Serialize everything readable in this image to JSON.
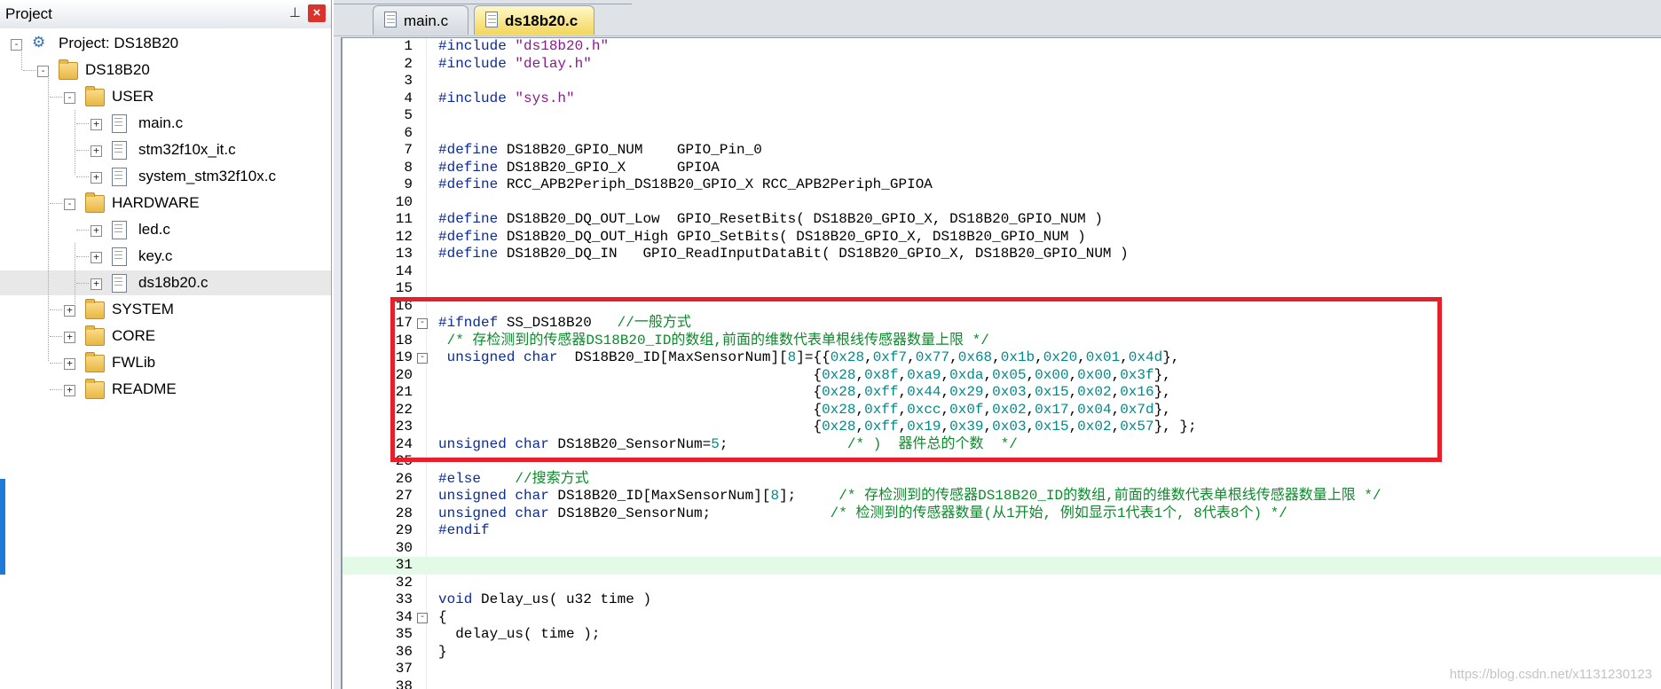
{
  "panel": {
    "title": "Project",
    "pin_icon": "pin-icon",
    "close_icon": "close-icon",
    "close_color": "#d9342b"
  },
  "tree": {
    "project_label": "Project: DS18B20",
    "target_label": "DS18B20",
    "groups": [
      {
        "name": "USER",
        "files": [
          "main.c",
          "stm32f10x_it.c",
          "system_stm32f10x.c"
        ]
      },
      {
        "name": "HARDWARE",
        "files": [
          "led.c",
          "key.c",
          "ds18b20.c"
        ]
      },
      {
        "name": "SYSTEM",
        "files": []
      },
      {
        "name": "CORE",
        "files": []
      },
      {
        "name": "FWLib",
        "files": []
      },
      {
        "name": "README",
        "files": []
      }
    ],
    "selected_file": "ds18b20.c"
  },
  "tabs": [
    {
      "label": "main.c",
      "active": false
    },
    {
      "label": "ds18b20.c",
      "active": true
    }
  ],
  "code_lines": [
    {
      "n": "1",
      "parts": [
        [
          "pp",
          "#include "
        ],
        [
          "str",
          "\"ds18b20.h\""
        ]
      ]
    },
    {
      "n": "2",
      "parts": [
        [
          "pp",
          "#include "
        ],
        [
          "str",
          "\"delay.h\""
        ]
      ]
    },
    {
      "n": "3",
      "parts": []
    },
    {
      "n": "4",
      "parts": [
        [
          "pp",
          "#include "
        ],
        [
          "str",
          "\"sys.h\""
        ]
      ]
    },
    {
      "n": "5",
      "parts": []
    },
    {
      "n": "6",
      "parts": []
    },
    {
      "n": "7",
      "parts": [
        [
          "pp",
          "#define "
        ],
        [
          "pl",
          "DS18B20_GPIO_NUM    GPIO_Pin_0"
        ]
      ]
    },
    {
      "n": "8",
      "parts": [
        [
          "pp",
          "#define "
        ],
        [
          "pl",
          "DS18B20_GPIO_X      GPIOA"
        ]
      ]
    },
    {
      "n": "9",
      "parts": [
        [
          "pp",
          "#define "
        ],
        [
          "pl",
          "RCC_APB2Periph_DS18B20_GPIO_X RCC_APB2Periph_GPIOA"
        ]
      ]
    },
    {
      "n": "10",
      "parts": []
    },
    {
      "n": "11",
      "parts": [
        [
          "pp",
          "#define "
        ],
        [
          "pl",
          "DS18B20_DQ_OUT_Low  GPIO_ResetBits( DS18B20_GPIO_X, DS18B20_GPIO_NUM )"
        ]
      ]
    },
    {
      "n": "12",
      "parts": [
        [
          "pp",
          "#define "
        ],
        [
          "pl",
          "DS18B20_DQ_OUT_High GPIO_SetBits( DS18B20_GPIO_X, DS18B20_GPIO_NUM )"
        ]
      ]
    },
    {
      "n": "13",
      "parts": [
        [
          "pp",
          "#define "
        ],
        [
          "pl",
          "DS18B20_DQ_IN   GPIO_ReadInputDataBit( DS18B20_GPIO_X, DS18B20_GPIO_NUM )"
        ]
      ]
    },
    {
      "n": "14",
      "parts": []
    },
    {
      "n": "15",
      "parts": []
    },
    {
      "n": "16",
      "parts": []
    },
    {
      "n": "17",
      "fold": "-",
      "parts": [
        [
          "pp",
          "#ifndef "
        ],
        [
          "pl",
          "SS_DS18B20   "
        ],
        [
          "cm",
          "//一般方式"
        ]
      ]
    },
    {
      "n": "18",
      "parts": [
        [
          "cm",
          " /* 存检测到的传感器DS18B20_ID的数组,前面的维数代表单根线传感器数量上限 */"
        ]
      ]
    },
    {
      "n": "19",
      "fold": "-",
      "parts": [
        [
          "kw",
          " unsigned char "
        ],
        [
          "pl",
          " DS18B20_ID[MaxSensorNum]["
        ],
        [
          "num",
          "8"
        ],
        [
          "pl",
          "]={{"
        ],
        [
          "num",
          "0x28"
        ],
        [
          "pl",
          ","
        ],
        [
          "num",
          "0xf7"
        ],
        [
          "pl",
          ","
        ],
        [
          "num",
          "0x77"
        ],
        [
          "pl",
          ","
        ],
        [
          "num",
          "0x68"
        ],
        [
          "pl",
          ","
        ],
        [
          "num",
          "0x1b"
        ],
        [
          "pl",
          ","
        ],
        [
          "num",
          "0x20"
        ],
        [
          "pl",
          ","
        ],
        [
          "num",
          "0x01"
        ],
        [
          "pl",
          ","
        ],
        [
          "num",
          "0x4d"
        ],
        [
          "pl",
          "},"
        ]
      ]
    },
    {
      "n": "20",
      "parts": [
        [
          "pl",
          "                                            {"
        ],
        [
          "num",
          "0x28"
        ],
        [
          "pl",
          ","
        ],
        [
          "num",
          "0x8f"
        ],
        [
          "pl",
          ","
        ],
        [
          "num",
          "0xa9"
        ],
        [
          "pl",
          ","
        ],
        [
          "num",
          "0xda"
        ],
        [
          "pl",
          ","
        ],
        [
          "num",
          "0x05"
        ],
        [
          "pl",
          ","
        ],
        [
          "num",
          "0x00"
        ],
        [
          "pl",
          ","
        ],
        [
          "num",
          "0x00"
        ],
        [
          "pl",
          ","
        ],
        [
          "num",
          "0x3f"
        ],
        [
          "pl",
          "},"
        ]
      ]
    },
    {
      "n": "21",
      "parts": [
        [
          "pl",
          "                                            {"
        ],
        [
          "num",
          "0x28"
        ],
        [
          "pl",
          ","
        ],
        [
          "num",
          "0xff"
        ],
        [
          "pl",
          ","
        ],
        [
          "num",
          "0x44"
        ],
        [
          "pl",
          ","
        ],
        [
          "num",
          "0x29"
        ],
        [
          "pl",
          ","
        ],
        [
          "num",
          "0x03"
        ],
        [
          "pl",
          ","
        ],
        [
          "num",
          "0x15"
        ],
        [
          "pl",
          ","
        ],
        [
          "num",
          "0x02"
        ],
        [
          "pl",
          ","
        ],
        [
          "num",
          "0x16"
        ],
        [
          "pl",
          "},"
        ]
      ]
    },
    {
      "n": "22",
      "parts": [
        [
          "pl",
          "                                            {"
        ],
        [
          "num",
          "0x28"
        ],
        [
          "pl",
          ","
        ],
        [
          "num",
          "0xff"
        ],
        [
          "pl",
          ","
        ],
        [
          "num",
          "0xcc"
        ],
        [
          "pl",
          ","
        ],
        [
          "num",
          "0x0f"
        ],
        [
          "pl",
          ","
        ],
        [
          "num",
          "0x02"
        ],
        [
          "pl",
          ","
        ],
        [
          "num",
          "0x17"
        ],
        [
          "pl",
          ","
        ],
        [
          "num",
          "0x04"
        ],
        [
          "pl",
          ","
        ],
        [
          "num",
          "0x7d"
        ],
        [
          "pl",
          "},"
        ]
      ]
    },
    {
      "n": "23",
      "parts": [
        [
          "pl",
          "                                            {"
        ],
        [
          "num",
          "0x28"
        ],
        [
          "pl",
          ","
        ],
        [
          "num",
          "0xff"
        ],
        [
          "pl",
          ","
        ],
        [
          "num",
          "0x19"
        ],
        [
          "pl",
          ","
        ],
        [
          "num",
          "0x39"
        ],
        [
          "pl",
          ","
        ],
        [
          "num",
          "0x03"
        ],
        [
          "pl",
          ","
        ],
        [
          "num",
          "0x15"
        ],
        [
          "pl",
          ","
        ],
        [
          "num",
          "0x02"
        ],
        [
          "pl",
          ","
        ],
        [
          "num",
          "0x57"
        ],
        [
          "pl",
          "}, };"
        ]
      ]
    },
    {
      "n": "24",
      "parts": [
        [
          "kw",
          "unsigned char "
        ],
        [
          "pl",
          "DS18B20_SensorNum="
        ],
        [
          "num",
          "5"
        ],
        [
          "pl",
          ";              "
        ],
        [
          "cm",
          "/* )  器件总的个数  */"
        ]
      ]
    },
    {
      "n": "25",
      "parts": []
    },
    {
      "n": "26",
      "parts": [
        [
          "pp",
          "#else    "
        ],
        [
          "cm",
          "//搜索方式"
        ]
      ]
    },
    {
      "n": "27",
      "parts": [
        [
          "kw",
          "unsigned char "
        ],
        [
          "pl",
          "DS18B20_ID[MaxSensorNum]["
        ],
        [
          "num",
          "8"
        ],
        [
          "pl",
          "];     "
        ],
        [
          "cm",
          "/* 存检测到的传感器DS18B20_ID的数组,前面的维数代表单根线传感器数量上限 */"
        ]
      ]
    },
    {
      "n": "28",
      "parts": [
        [
          "kw",
          "unsigned char "
        ],
        [
          "pl",
          "DS18B20_SensorNum;              "
        ],
        [
          "cm",
          "/* 检测到的传感器数量(从1开始, 例如显示1代表1个, 8代表8个) */"
        ]
      ]
    },
    {
      "n": "29",
      "parts": [
        [
          "pp",
          "#endif"
        ]
      ]
    },
    {
      "n": "30",
      "parts": []
    },
    {
      "n": "31",
      "highlight": true,
      "parts": []
    },
    {
      "n": "32",
      "parts": []
    },
    {
      "n": "33",
      "parts": [
        [
          "kw",
          "void "
        ],
        [
          "pl",
          "Delay_us( u32 time )"
        ]
      ]
    },
    {
      "n": "34",
      "fold": "-",
      "parts": [
        [
          "pl",
          "{"
        ]
      ]
    },
    {
      "n": "35",
      "parts": [
        [
          "pl",
          "  delay_us( time );"
        ]
      ]
    },
    {
      "n": "36",
      "parts": [
        [
          "pl",
          "}"
        ]
      ]
    },
    {
      "n": "37",
      "parts": []
    },
    {
      "n": "38",
      "parts": []
    }
  ],
  "colors": {
    "preprocessor": "#0b2a9c",
    "string": "#8a1a8a",
    "number": "#008a8a",
    "comment": "#0d8a2b",
    "highlight_box": "#e5202b",
    "current_line": "#e3fbe6"
  },
  "watermark": "https://blog.csdn.net/x1131230123"
}
